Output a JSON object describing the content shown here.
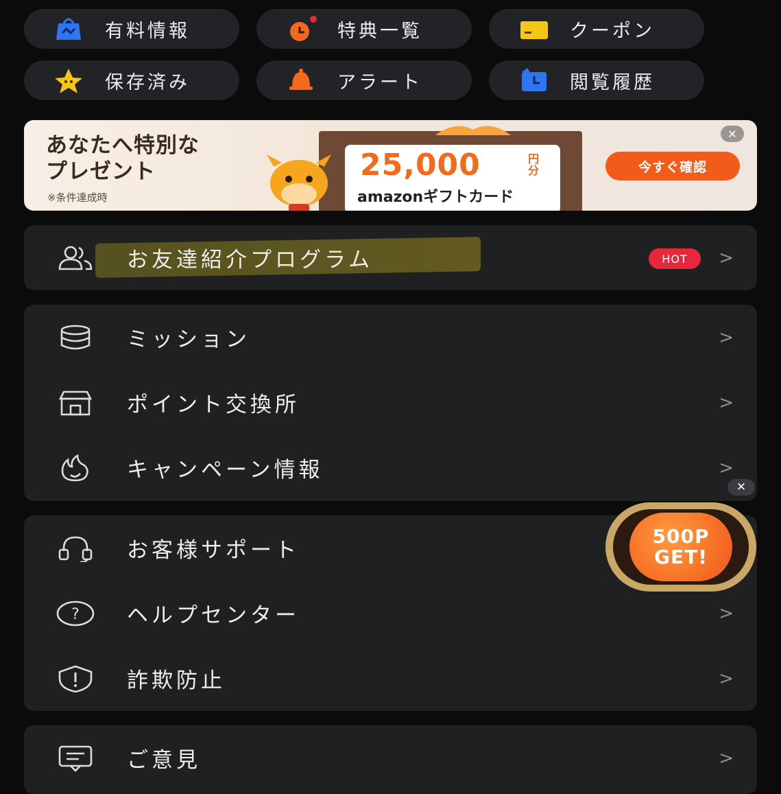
{
  "quick_links": [
    {
      "label": "有料情報",
      "icon": "paid-bag-icon"
    },
    {
      "label": "特典一覧",
      "icon": "gift-clock-icon"
    },
    {
      "label": "クーポン",
      "icon": "coupon-icon"
    },
    {
      "label": "保存済み",
      "icon": "star-icon"
    },
    {
      "label": "アラート",
      "icon": "bell-icon"
    },
    {
      "label": "閲覧履歴",
      "icon": "history-icon"
    }
  ],
  "banner": {
    "headline_1": "あなたへ特別な",
    "headline_2": "プレゼント",
    "note": "※条件達成時",
    "amount": "25,000",
    "yen": "円分",
    "gift": "amazonギフトカード",
    "cta": "今すぐ確認"
  },
  "referral": {
    "label": "お友達紹介プログラム",
    "badge": "HOT"
  },
  "menu_group_1": [
    {
      "label": "ミッション",
      "icon": "coins-icon"
    },
    {
      "label": "ポイント交換所",
      "icon": "store-icon"
    },
    {
      "label": "キャンペーン情報",
      "icon": "flame-icon"
    }
  ],
  "menu_group_2": [
    {
      "label": "お客様サポート",
      "icon": "headset-icon"
    },
    {
      "label": "ヘルプセンター",
      "icon": "help-icon"
    },
    {
      "label": "詐欺防止",
      "icon": "shield-alert-icon"
    }
  ],
  "menu_group_3": [
    {
      "label": "ご意見",
      "icon": "feedback-icon"
    }
  ],
  "promo_badge": {
    "text": "500P GET!"
  },
  "chevron": ">",
  "close_glyph": "✕",
  "colors": {
    "accent": "#f25b1a",
    "hot": "#e5283c",
    "background": "#0b0b0c",
    "card": "#1f2022"
  }
}
